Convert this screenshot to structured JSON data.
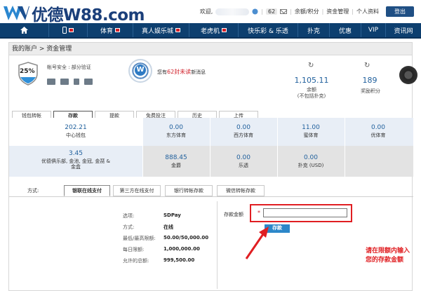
{
  "header": {
    "brand_cn": "优德",
    "brand_en": "W88.com",
    "welcome": "欢迎,",
    "count": "62",
    "links": [
      "余额/积分",
      "资金管理",
      "个人资料"
    ],
    "logout": "登出"
  },
  "nav": [
    "体育",
    "真人娱乐城",
    "老虎机",
    "快乐彩 & 乐透",
    "扑克",
    "优惠",
    "VIP",
    "资讯网"
  ],
  "breadcrumb": "我的账户 > 资金管理",
  "account": {
    "security_percent": "25%",
    "security_label": "帐号安全 : 部分验证",
    "msg_prefix": "您有",
    "msg_count": "62封未读",
    "msg_suffix": "新消息",
    "balance": "1,105.11",
    "balance_label": "余额",
    "balance_note": "(不包括扑克)",
    "points": "189",
    "points_label": "奖励积分"
  },
  "tabs": [
    "钱包转帐",
    "存款",
    "提款",
    "免费投注",
    "历史",
    "上传"
  ],
  "wallets": [
    {
      "value": "202.21",
      "label": "中心钱包"
    },
    {
      "value": "0.00",
      "label": "东方体育"
    },
    {
      "value": "0.00",
      "label": "西方体育"
    },
    {
      "value": "11.00",
      "label": "蜜体育"
    },
    {
      "value": "0.00",
      "label": "优体育"
    },
    {
      "value": "3.45",
      "label": "优德俱乐部, 金池, 金冠, 金琵 & 金盒"
    },
    {
      "value": "888.45",
      "label": "金爵"
    },
    {
      "value": "0.00",
      "label": "乐透"
    },
    {
      "value": "0.00",
      "label": "扑克 (USD)"
    }
  ],
  "deposit": {
    "method_label": "方式:",
    "methods": [
      "银联在线支付",
      "第三方在线支付",
      "银行转帐存款",
      "微信转帐存款"
    ],
    "details": [
      {
        "label": "选项:",
        "value": "SDPay"
      },
      {
        "label": "方式:",
        "value": "在线"
      },
      {
        "label": "最低/最高限额:",
        "value": "50.00/50,000.00"
      },
      {
        "label": "每日限额:",
        "value": "1,000,000.00"
      },
      {
        "label": "允许的总额:",
        "value": "999,500.00"
      }
    ],
    "amount_label": "存款金额",
    "required_mark": "*",
    "button": "存款",
    "note": "请在限额内输入您的存款金额"
  },
  "colors": {
    "nav": "#0d3f6f",
    "accent": "#1f5f9c",
    "annotation": "#e01e22",
    "button": "#2c87c9"
  }
}
